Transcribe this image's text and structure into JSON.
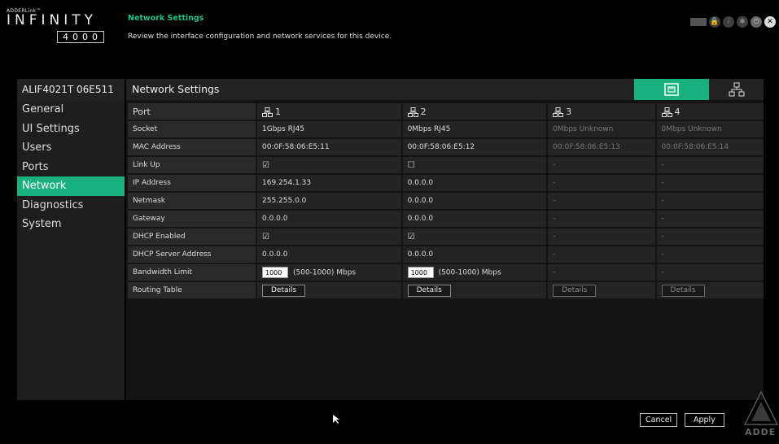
{
  "logo": {
    "brand": "ADDERLink™",
    "name": "INFINITY",
    "model": "4000"
  },
  "header": {
    "title": "Network Settings",
    "description": "Review the interface configuration and network services for this device."
  },
  "top_icons": [
    "keyboard-icon",
    "lock-icon",
    "info-icon",
    "gear-icon",
    "power-icon",
    "close-icon"
  ],
  "device_name": "ALIF4021T 06E511",
  "sidebar": {
    "items": [
      {
        "label": "General"
      },
      {
        "label": "UI Settings"
      },
      {
        "label": "Users"
      },
      {
        "label": "Ports"
      },
      {
        "label": "Network",
        "active": true
      },
      {
        "label": "Diagnostics"
      },
      {
        "label": "System"
      }
    ]
  },
  "content": {
    "title": "Network Settings",
    "tab_colors": {
      "active": "#18b07f"
    }
  },
  "table": {
    "port_label": "Port",
    "ports": [
      "1",
      "2",
      "3",
      "4"
    ],
    "rows": [
      {
        "label": "Socket",
        "values": [
          "1Gbps RJ45",
          "0Mbps RJ45",
          "0Mbps Unknown",
          "0Mbps Unknown"
        ]
      },
      {
        "label": "MAC Address",
        "values": [
          "00:0F:58:06:E5:11",
          "00:0F:58:06:E5:12",
          "00:0F:58:06:E5:13",
          "00:0F:58:06:E5:14"
        ]
      },
      {
        "label": "Link Up",
        "values": [
          "☑",
          "☐",
          "-",
          "-"
        ]
      },
      {
        "label": "IP Address",
        "values": [
          "169.254.1.33",
          "0.0.0.0",
          "-",
          "-"
        ]
      },
      {
        "label": "Netmask",
        "values": [
          "255.255.0.0",
          "0.0.0.0",
          "-",
          "-"
        ]
      },
      {
        "label": "Gateway",
        "values": [
          "0.0.0.0",
          "0.0.0.0",
          "-",
          "-"
        ]
      },
      {
        "label": "DHCP Enabled",
        "values": [
          "☑",
          "☑",
          "-",
          "-"
        ]
      },
      {
        "label": "DHCP Server Address",
        "values": [
          "0.0.0.0",
          "0.0.0.0",
          "-",
          "-"
        ]
      }
    ],
    "bandwidth": {
      "label": "Bandwidth Limit",
      "input_value": "1000",
      "range_text": "(500-1000) Mbps",
      "port3": "-",
      "port4": "-"
    },
    "routing": {
      "label": "Routing Table",
      "button": "Details"
    }
  },
  "footer": {
    "cancel": "Cancel",
    "apply": "Apply",
    "adder_text": "ADDE"
  }
}
